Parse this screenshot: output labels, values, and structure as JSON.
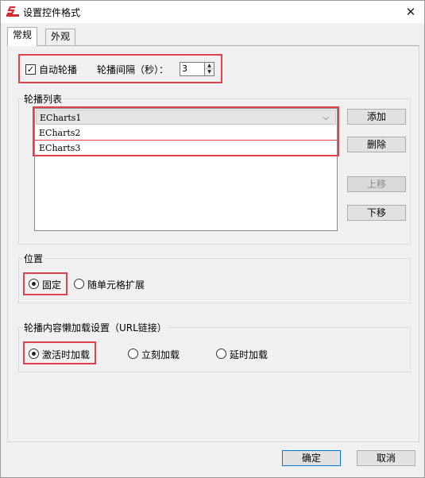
{
  "window": {
    "title": "设置控件格式",
    "close_glyph": "✕",
    "app_icon": "red-s-logo"
  },
  "tabs": [
    {
      "label": "常规"
    },
    {
      "label": "外观"
    }
  ],
  "carousel": {
    "auto_label": "自动轮播",
    "auto_checked": true,
    "interval_label": "轮播间隔（秒）：",
    "interval_value": "3"
  },
  "list": {
    "title": "轮播列表",
    "items": [
      "ECharts1",
      "ECharts2",
      "ECharts3"
    ],
    "selected_index": 0
  },
  "buttons": {
    "add": "添加",
    "delete": "删除",
    "up": "上移",
    "down": "下移",
    "ok": "确定",
    "cancel": "取消"
  },
  "position": {
    "title": "位置",
    "options": [
      "固定",
      "随单元格扩展"
    ],
    "selected": "固定"
  },
  "lazy": {
    "title": "轮播内容懒加载设置（URL链接）",
    "options": [
      "激活时加载",
      "立刻加载",
      "延时加载"
    ],
    "selected": "激活时加载"
  },
  "colors": {
    "highlight": "#e0414a",
    "logo_red": "#d9272e",
    "primary_border": "#0078d7"
  }
}
